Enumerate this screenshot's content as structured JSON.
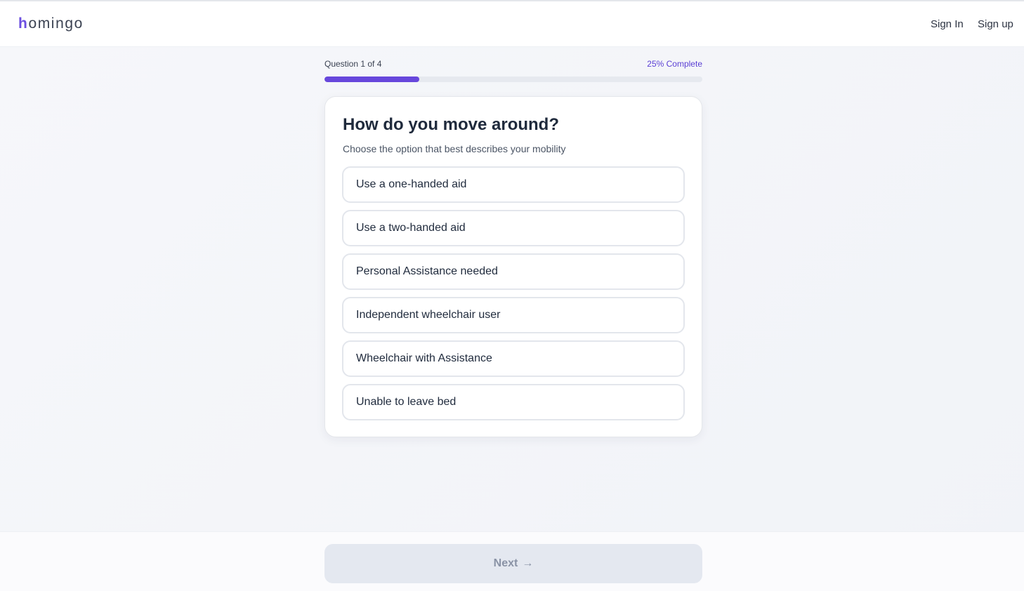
{
  "brand": {
    "logo_first": "h",
    "logo_rest": "omingo"
  },
  "nav": {
    "sign_in": "Sign In",
    "sign_up": "Sign up"
  },
  "progress": {
    "question_label": "Question 1 of 4",
    "percent_label": "25% Complete",
    "fraction": 0.25,
    "color": "#6747dc"
  },
  "question": {
    "title": "How do you move around?",
    "subtitle": "Choose the option that best describes your mobility",
    "options": [
      "Use a one-handed aid",
      "Use a two-handed aid",
      "Personal Assistance needed",
      "Independent wheelchair user",
      "Wheelchair with Assistance",
      "Unable to leave bed"
    ]
  },
  "footer": {
    "next_label": "Next",
    "next_icon": "arrow-right-icon",
    "next_enabled": false
  }
}
